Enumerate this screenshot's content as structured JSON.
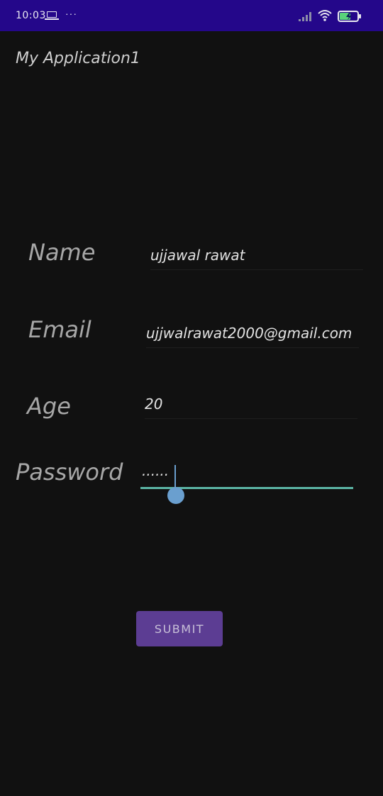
{
  "status_bar": {
    "time": "10:03",
    "more_symbol": "···",
    "background_color": "#24078a",
    "icons": [
      "laptop-icon",
      "more-icon",
      "signal-icon",
      "wifi-icon",
      "battery-charging-icon"
    ]
  },
  "app": {
    "title": "My Application1",
    "background_color": "#111111"
  },
  "form": {
    "name_label": "Name",
    "name_value": "ujjawal rawat",
    "email_label": "Email",
    "email_value": "ujjwalrawat2000@gmail.com",
    "age_label": "Age",
    "age_value": "20",
    "password_label": "Password",
    "password_value": "......",
    "underline_color": "#5bb5a5",
    "cursor_color": "#6a9fcf"
  },
  "submit": {
    "label": "SUBMIT",
    "color": "#5c3d93"
  }
}
